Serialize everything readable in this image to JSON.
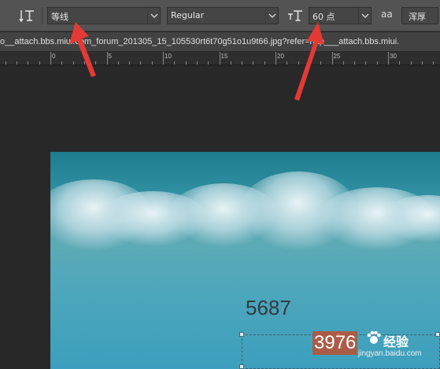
{
  "toolbar": {
    "orientation_icon": "text-orientation-icon",
    "font_family": "等线",
    "font_style": "Regular",
    "size_icon": "font-size-icon",
    "font_size": "60 点",
    "antialias_icon": "antialias-icon",
    "antialias_label": "aa",
    "antialias_value": "浑厚"
  },
  "document": {
    "tab_title": "o__attach.bbs.miui.com_forum_201305_15_105530rt6t70g51o1u9t66.jpg?refer=http___attach.bbs.miui."
  },
  "ruler": {
    "labels": [
      "0",
      "5",
      "10",
      "15",
      "20",
      "25",
      "30"
    ]
  },
  "canvas": {
    "text_layer_1": "5687",
    "text_layer_2": "3976"
  },
  "watermark": {
    "brand": "经验",
    "url": "jingyan.baidu.com"
  },
  "colors": {
    "options_bar": "#535353",
    "workspace": "#282828",
    "annotation_arrow": "#e53935",
    "sky_top": "#1e7d8e",
    "sky_bottom": "#3c9fbd"
  }
}
